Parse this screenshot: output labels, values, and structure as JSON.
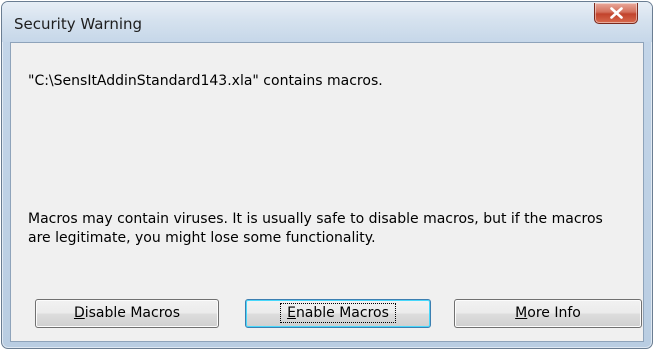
{
  "window": {
    "title": "Security Warning",
    "close_icon": "close-x-icon"
  },
  "message": {
    "file_line": "\"C:\\SensItAddinStandard143.xla\" contains macros.",
    "warning": "Macros may contain viruses. It is usually safe to disable macros, but if the macros are legitimate, you might lose some functionality."
  },
  "buttons": {
    "disable": {
      "accel": "D",
      "rest": "isable Macros"
    },
    "enable": {
      "accel": "E",
      "rest": "nable Macros"
    },
    "more_info": {
      "accel": "M",
      "rest": "ore Info"
    }
  },
  "colors": {
    "close_button": "#c2432c",
    "default_button_border": "#3c7fb1",
    "frame": "#c3d5e8",
    "client_background": "#f0f0f0"
  }
}
